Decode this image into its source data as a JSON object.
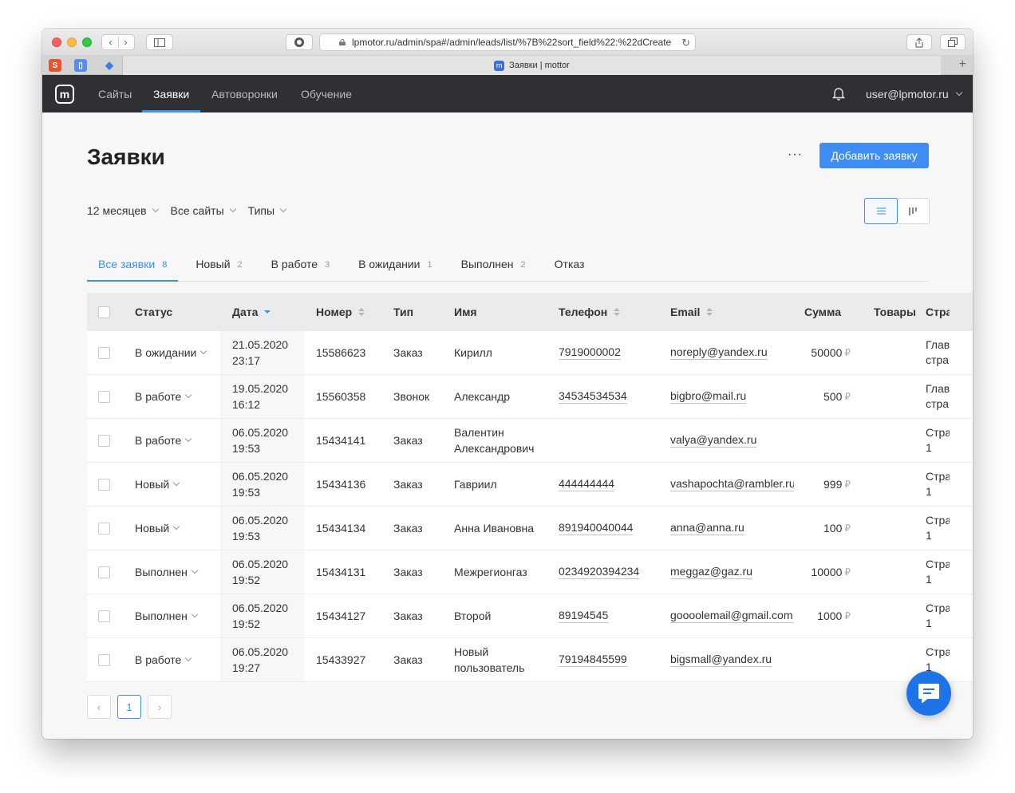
{
  "browser": {
    "url": "lpmotor.ru/admin/spa#/admin/leads/list/%7B%22sort_field%22:%22dCreate",
    "tab_title": "Заявки | mottor",
    "tab_icon_letter": "m"
  },
  "nav": {
    "logo_letter": "m",
    "items": [
      {
        "label": "Сайты"
      },
      {
        "label": "Заявки"
      },
      {
        "label": "Автоворонки"
      },
      {
        "label": "Обучение"
      }
    ],
    "user": "user@lpmotor.ru"
  },
  "page": {
    "title": "Заявки",
    "more_label": "···",
    "add_button": "Добавить заявку"
  },
  "filters": [
    {
      "label": "12 месяцев"
    },
    {
      "label": "Все сайты"
    },
    {
      "label": "Типы"
    }
  ],
  "status_tabs": [
    {
      "label": "Все заявки",
      "count": "8"
    },
    {
      "label": "Новый",
      "count": "2"
    },
    {
      "label": "В работе",
      "count": "3"
    },
    {
      "label": "В ожидании",
      "count": "1"
    },
    {
      "label": "Выполнен",
      "count": "2"
    },
    {
      "label": "Отказ",
      "count": ""
    }
  ],
  "table": {
    "columns": {
      "status": "Статус",
      "date": "Дата",
      "number": "Номер",
      "type": "Тип",
      "name": "Имя",
      "phone": "Телефон",
      "email": "Email",
      "sum": "Сумма",
      "goods": "Товары",
      "page": "Стра"
    },
    "currency": "₽",
    "rows": [
      {
        "status": "В ожидании",
        "date": "21.05.2020",
        "time": "23:17",
        "number": "15586623",
        "type": "Заказ",
        "name": "Кирилл",
        "phone": "7919000002",
        "email": "noreply@yandex.ru",
        "sum": "50000",
        "page1": "Глав",
        "page2": "стра"
      },
      {
        "status": "В работе",
        "date": "19.05.2020",
        "time": "16:12",
        "number": "15560358",
        "type": "Звонок",
        "name": "Александр",
        "phone": "34534534534",
        "email": "bigbro@mail.ru",
        "sum": "500",
        "page1": "Глав",
        "page2": "стра"
      },
      {
        "status": "В работе",
        "date": "06.05.2020",
        "time": "19:53",
        "number": "15434141",
        "type": "Заказ",
        "name": "Валентин Александрович",
        "phone": "",
        "email": "valya@yandex.ru",
        "sum": "",
        "page1": "Стра",
        "page2": "1"
      },
      {
        "status": "Новый",
        "date": "06.05.2020",
        "time": "19:53",
        "number": "15434136",
        "type": "Заказ",
        "name": "Гавриил",
        "phone": "444444444",
        "email": "vashapochta@rambler.ru",
        "sum": "999",
        "page1": "Стра",
        "page2": "1"
      },
      {
        "status": "Новый",
        "date": "06.05.2020",
        "time": "19:53",
        "number": "15434134",
        "type": "Заказ",
        "name": "Анна Ивановна",
        "phone": "891940040044",
        "email": "anna@anna.ru",
        "sum": "100",
        "page1": "Стра",
        "page2": "1"
      },
      {
        "status": "Выполнен",
        "date": "06.05.2020",
        "time": "19:52",
        "number": "15434131",
        "type": "Заказ",
        "name": "Межрегионгаз",
        "phone": "0234920394234",
        "email": "meggaz@gaz.ru",
        "sum": "10000",
        "page1": "Стра",
        "page2": "1"
      },
      {
        "status": "Выполнен",
        "date": "06.05.2020",
        "time": "19:52",
        "number": "15434127",
        "type": "Заказ",
        "name": "Второй",
        "phone": "89194545",
        "email": "goooolemail@gmail.com",
        "sum": "1000",
        "page1": "Стра",
        "page2": "1"
      },
      {
        "status": "В работе",
        "date": "06.05.2020",
        "time": "19:27",
        "number": "15433927",
        "type": "Заказ",
        "name": "Новый пользователь",
        "phone": "79194845599",
        "email": "bigsmall@yandex.ru",
        "sum": "",
        "page1": "Стра",
        "page2": "1"
      }
    ]
  },
  "pagination": {
    "prev": "‹",
    "current": "1",
    "next": "›"
  },
  "colors": {
    "accent": "#3d8df5",
    "nav_bg": "#2f3033",
    "chat_button": "#1e73e8"
  }
}
